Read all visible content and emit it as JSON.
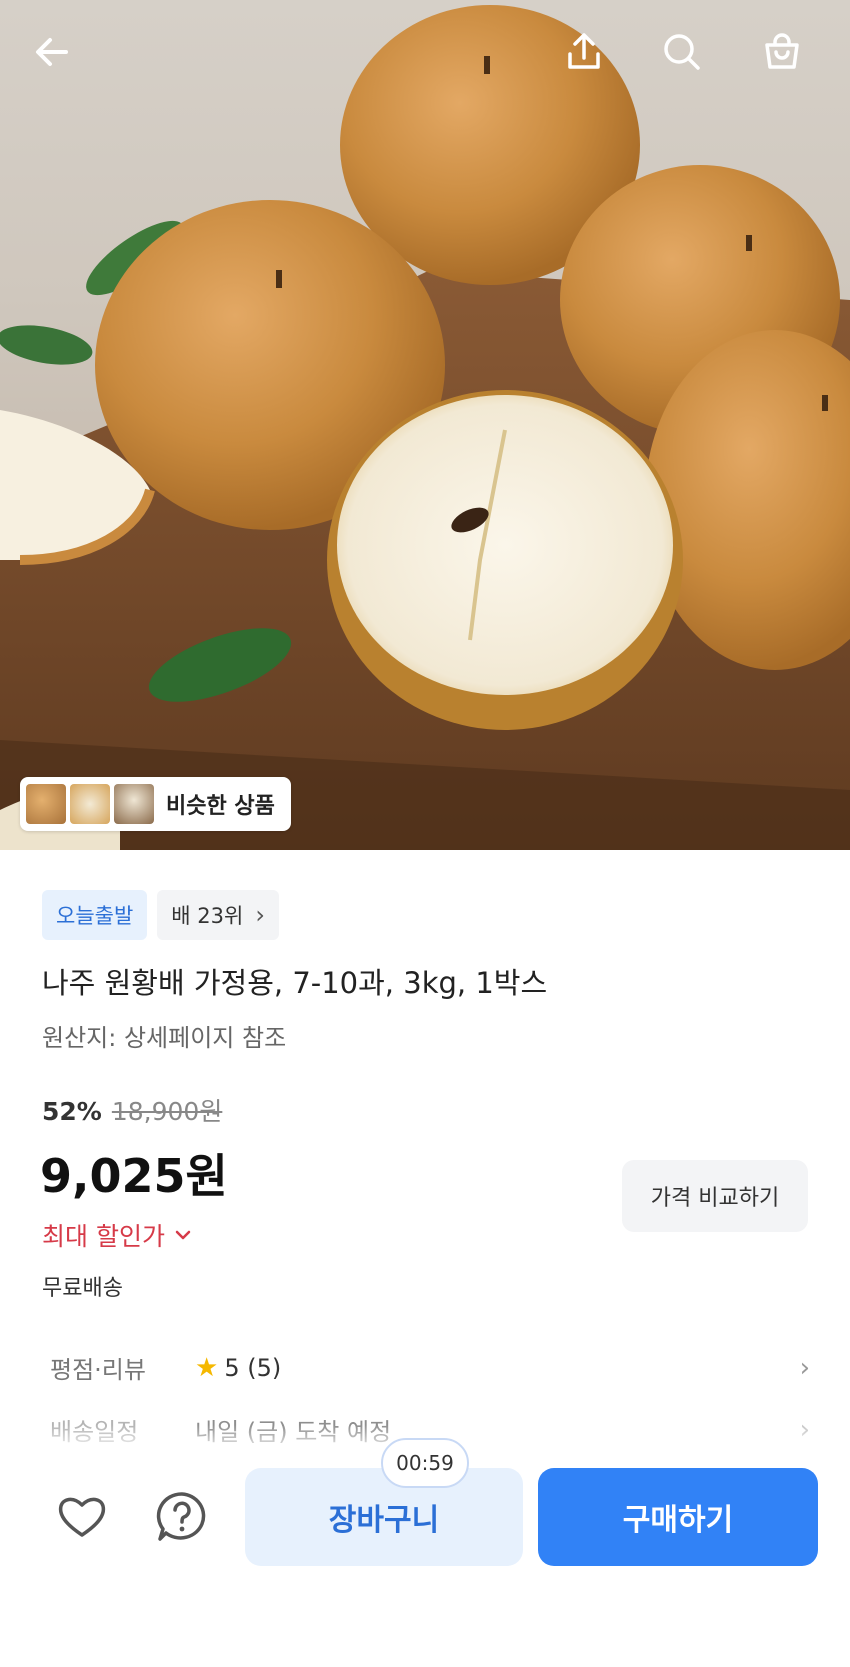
{
  "header": {
    "back_icon": "arrow-left-icon",
    "share_icon": "share-icon",
    "search_icon": "search-icon",
    "cart_icon": "shopping-bag-icon"
  },
  "hero": {
    "similar_label": "비슷한 상품"
  },
  "product": {
    "badge_today": "오늘출발",
    "rank": "배 23위",
    "rank_chevron": "›",
    "title": "나주 원황배 가정용, 7-10과, 3kg, 1박스",
    "origin": "원산지: 상세페이지 참조",
    "discount": "52%",
    "original_price": "18,900원",
    "price": "9,025원",
    "compare_label": "가격 비교하기",
    "max_discount": "최대 할인가",
    "shipping": "무료배송"
  },
  "info": {
    "rating_label": "평점·리뷰",
    "rating_star": "★",
    "rating_value": "5 (5)",
    "delivery_label": "배송일정",
    "delivery_value": "내일 (금) 도착 예정",
    "chevron": "›"
  },
  "bottom": {
    "cart_label": "장바구니",
    "buy_label": "구매하기",
    "timer": "00:59",
    "heart_icon": "heart-icon",
    "question_icon": "question-icon"
  },
  "colors": {
    "accent": "#3182f6",
    "accent_light": "#e7f1fd",
    "sale_red": "#d63a48"
  }
}
